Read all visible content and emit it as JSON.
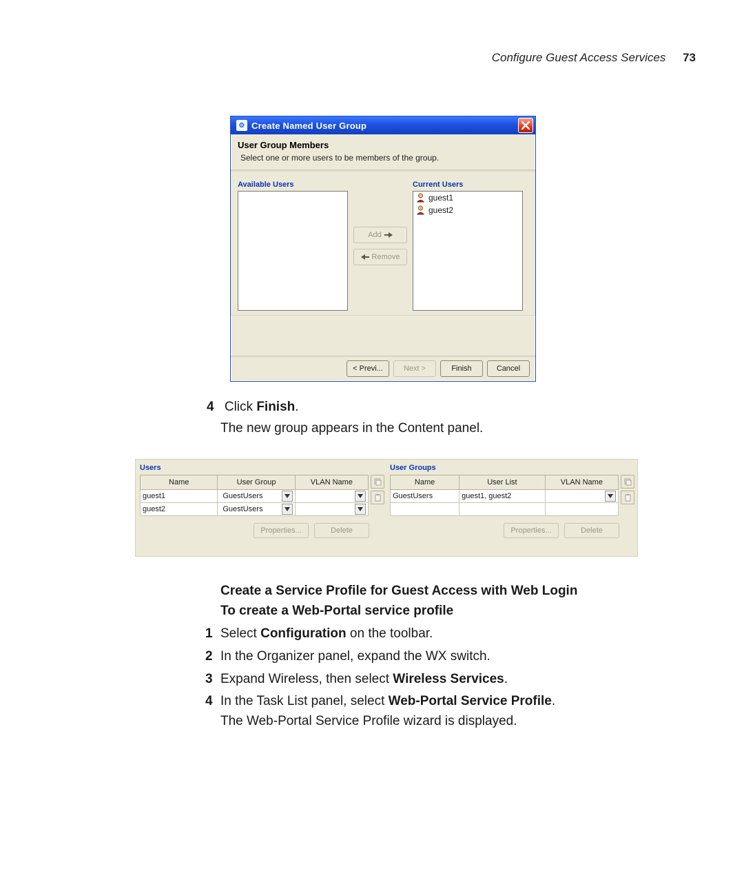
{
  "header": {
    "title_italic": "Configure Guest Access Services",
    "page": "73"
  },
  "wizard": {
    "title": "Create Named User Group",
    "panel_heading": "User Group Members",
    "panel_sub": "Select one or more users to be members of the group.",
    "available_label": "Available Users",
    "current_label": "Current Users",
    "available_users": [],
    "current_users": [
      "guest1",
      "guest2"
    ],
    "buttons": {
      "add": "Add",
      "remove": "Remove"
    },
    "footer": {
      "prev": "< Previ...",
      "next": "Next >",
      "finish": "Finish",
      "cancel": "Cancel"
    }
  },
  "step4": {
    "num": "4",
    "prefix": "Click ",
    "bold": "Finish",
    "suffix": ".",
    "line2": "The new group appears in the Content panel."
  },
  "tables": {
    "users_title": "Users",
    "groups_title": "User Groups",
    "users_cols": [
      "Name",
      "User Group",
      "VLAN Name"
    ],
    "users_rows": [
      {
        "name": "guest1",
        "group": "GuestUsers",
        "vlan": ""
      },
      {
        "name": "guest2",
        "group": "GuestUsers",
        "vlan": ""
      }
    ],
    "groups_cols": [
      "Name",
      "User List",
      "VLAN Name"
    ],
    "groups_rows": [
      {
        "name": "GuestUsers",
        "list": "guest1, guest2",
        "vlan": ""
      }
    ],
    "footer": {
      "properties": "Properties...",
      "delete": "Delete"
    }
  },
  "lower": {
    "h1": "Create a Service Profile for Guest Access with Web Login",
    "h2": "To create a Web-Portal service profile",
    "s1": {
      "n": "1",
      "a": "Select ",
      "b": "Configuration",
      "c": " on the toolbar."
    },
    "s2": {
      "n": "2",
      "t": "In the Organizer panel, expand the WX switch."
    },
    "s3": {
      "n": "3",
      "a": "Expand Wireless, then select ",
      "b": "Wireless Services",
      "c": "."
    },
    "s4": {
      "n": "4",
      "a": "In the Task List panel, select ",
      "b": "Web-Portal Service Profile",
      "c": "."
    },
    "s4b": "The Web-Portal Service Profile wizard is displayed."
  }
}
